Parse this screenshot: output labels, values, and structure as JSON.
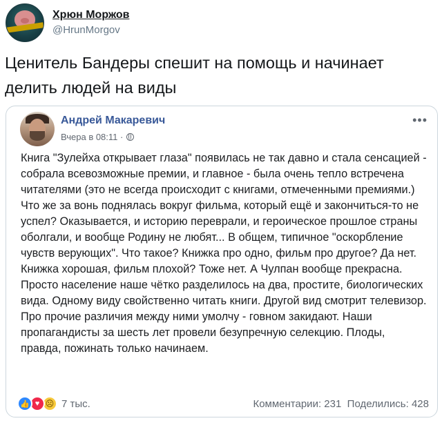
{
  "tweet": {
    "author_name": "Хрюн Моржов",
    "author_handle": "@HrunMorgov",
    "text": "Ценитель Бандеры спешит на помощь и начинает делить людей на виды"
  },
  "fb_post": {
    "author": "Андрей Макаревич",
    "timestamp": "Вчера в 08:11 ·",
    "more_label": "•••",
    "body": "Книга \"Зулейха открывает глаза\" появилась не так давно и стала сенсацией - собрала всевозможные премии, и главное - была очень тепло встречена читателями (это не всегда происходит с книгами, отмеченными премиями.) Что же за вонь поднялась вокруг фильма, который ещё и закончиться-то не успел? Оказывается, и историю переврали, и героическое прошлое страны оболгали, и вообще Родину не любят... В общем, типичное \"оскорбление чувств верующих\". Что такое? Книжка про одно, фильм про другое? Да нет. Книжка хорошая, фильм плохой? Тоже нет. А Чулпан вообще прекрасна. Просто население наше чётко разделилось на два, простите, биологических вида. Одному виду свойственно читать книги. Другой вид смотрит телевизор. Про прочие различия между ними умолчу - говном закидают. Наши пропагандисты за шесть лет провели безупречную селекцию. Плоды, правда, пожинать только начинаем.",
    "reactions_count": "7 тыс.",
    "comments": "Комментарии: 231",
    "shares": "Поделились: 428",
    "reaction_icons": [
      "like-icon",
      "love-icon",
      "sad-icon"
    ],
    "colors": {
      "name": "#385898",
      "like": "#2d88ff",
      "love": "#f0284a",
      "sad": "#f7c93b"
    }
  }
}
